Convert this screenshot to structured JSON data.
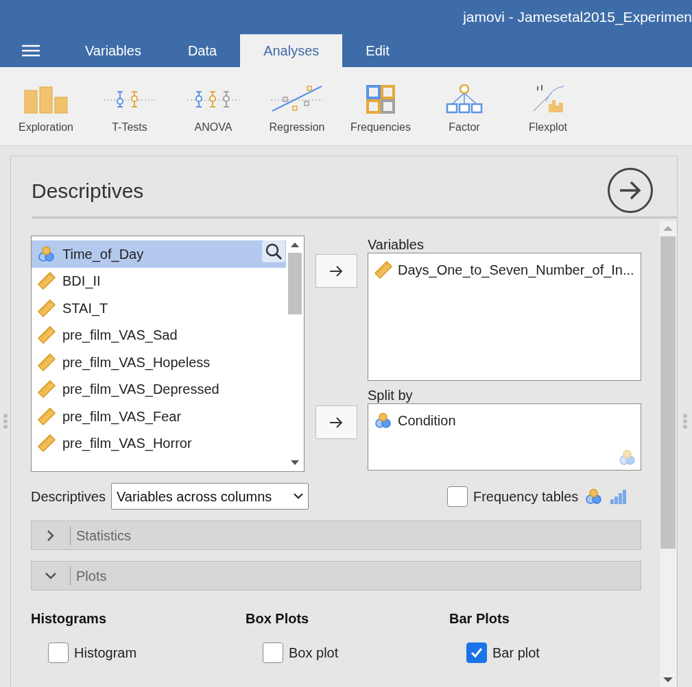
{
  "window": {
    "title": "jamovi - Jamesetal2015_Experimen"
  },
  "tabs": [
    {
      "label": "Variables",
      "selected": false
    },
    {
      "label": "Data",
      "selected": false
    },
    {
      "label": "Analyses",
      "selected": true
    },
    {
      "label": "Edit",
      "selected": false
    }
  ],
  "toolbar": [
    {
      "label": "Exploration",
      "kind": "bars"
    },
    {
      "label": "T-Tests",
      "kind": "ttest"
    },
    {
      "label": "ANOVA",
      "kind": "anova"
    },
    {
      "label": "Regression",
      "kind": "regression"
    },
    {
      "label": "Frequencies",
      "kind": "frequencies"
    },
    {
      "label": "Factor",
      "kind": "factor"
    },
    {
      "label": "Flexplot",
      "kind": "flexplot"
    }
  ],
  "analysis": {
    "title": "Descriptives"
  },
  "variable_list": [
    {
      "name": "Time_of_Day",
      "kind": "nominal",
      "selected": true
    },
    {
      "name": "BDI_II",
      "kind": "continuous",
      "selected": false
    },
    {
      "name": "STAI_T",
      "kind": "continuous",
      "selected": false
    },
    {
      "name": "pre_film_VAS_Sad",
      "kind": "continuous",
      "selected": false
    },
    {
      "name": "pre_film_VAS_Hopeless",
      "kind": "continuous",
      "selected": false
    },
    {
      "name": "pre_film_VAS_Depressed",
      "kind": "continuous",
      "selected": false
    },
    {
      "name": "pre_film_VAS_Fear",
      "kind": "continuous",
      "selected": false
    },
    {
      "name": "pre_film_VAS_Horror",
      "kind": "continuous",
      "selected": false
    }
  ],
  "targets": [
    {
      "label": "Variables",
      "items": [
        {
          "name": "Days_One_to_Seven_Number_of_In...",
          "kind": "continuous"
        }
      ],
      "kind": "variables"
    },
    {
      "label": "Split by",
      "items": [
        {
          "name": "Condition",
          "kind": "nominal"
        }
      ],
      "kind": "grouping"
    }
  ],
  "descriptives_option": {
    "label": "Descriptives",
    "value": "Variables across columns"
  },
  "frequency_tables": {
    "label": "Frequency tables",
    "checked": false
  },
  "sections": [
    {
      "label": "Statistics",
      "expanded": false
    },
    {
      "label": "Plots",
      "expanded": true
    }
  ],
  "plot_groups": [
    {
      "title": "Histograms",
      "options": [
        {
          "label": "Histogram",
          "checked": false
        }
      ]
    },
    {
      "title": "Box Plots",
      "options": [
        {
          "label": "Box plot",
          "checked": false
        }
      ]
    },
    {
      "title": "Bar Plots",
      "options": [
        {
          "label": "Bar plot",
          "checked": true
        }
      ]
    }
  ]
}
